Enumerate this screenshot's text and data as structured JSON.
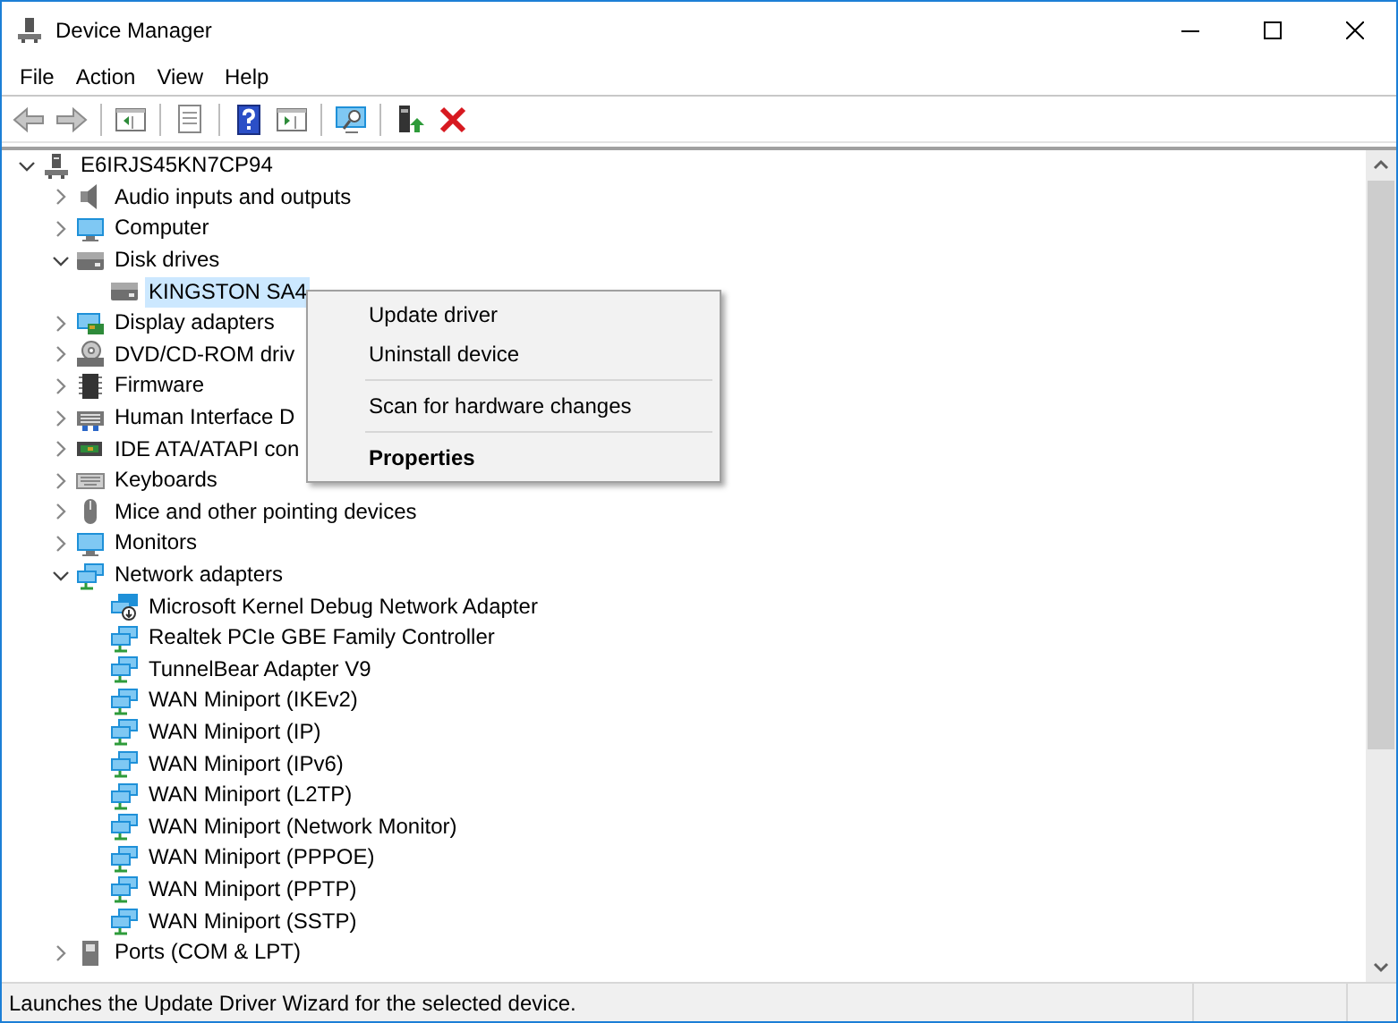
{
  "window": {
    "title": "Device Manager"
  },
  "menu_bar": [
    "File",
    "Action",
    "View",
    "Help"
  ],
  "toolbar": [
    {
      "kind": "back",
      "disabled": true
    },
    {
      "kind": "forward",
      "disabled": true
    },
    {
      "kind": "separator"
    },
    {
      "kind": "tree",
      "disabled": false
    },
    {
      "kind": "separator"
    },
    {
      "kind": "sheet",
      "disabled": false
    },
    {
      "kind": "separator"
    },
    {
      "kind": "help",
      "disabled": false
    },
    {
      "kind": "pane",
      "disabled": false
    },
    {
      "kind": "separator"
    },
    {
      "kind": "scan",
      "disabled": false
    },
    {
      "kind": "separator"
    },
    {
      "kind": "update",
      "disabled": false
    },
    {
      "kind": "remove",
      "disabled": false
    }
  ],
  "tree": {
    "label": "E6IRJS45KN7CP94",
    "kind": "computer",
    "expanded": true,
    "selected": false,
    "children": [
      {
        "label": "Audio inputs and outputs",
        "kind": "audio",
        "expanded": false,
        "selected": false
      },
      {
        "label": "Computer",
        "kind": "monitor",
        "expanded": false,
        "selected": false
      },
      {
        "label": "Disk drives",
        "kind": "disk",
        "expanded": true,
        "selected": false,
        "children": [
          {
            "label": "KINGSTON SA4",
            "kind": "disk",
            "selected": true
          }
        ]
      },
      {
        "label": "Display adapters",
        "kind": "display",
        "expanded": false,
        "selected": false
      },
      {
        "label": "DVD/CD-ROM driv",
        "kind": "dvd",
        "expanded": false,
        "selected": false
      },
      {
        "label": "Firmware",
        "kind": "chip",
        "expanded": false,
        "selected": false
      },
      {
        "label": "Human Interface D",
        "kind": "hid",
        "expanded": false,
        "selected": false
      },
      {
        "label": "IDE ATA/ATAPI con",
        "kind": "card",
        "expanded": false,
        "selected": false
      },
      {
        "label": "Keyboards",
        "kind": "keyboard",
        "expanded": false,
        "selected": false
      },
      {
        "label": "Mice and other pointing devices",
        "kind": "mouse",
        "expanded": false,
        "selected": false
      },
      {
        "label": "Monitors",
        "kind": "monitor",
        "expanded": false,
        "selected": false
      },
      {
        "label": "Network adapters",
        "kind": "network",
        "expanded": true,
        "selected": false,
        "children": [
          {
            "label": "Microsoft Kernel Debug Network Adapter",
            "kind": "debug",
            "selected": false
          },
          {
            "label": "Realtek PCIe GBE Family Controller",
            "kind": "network",
            "selected": false
          },
          {
            "label": "TunnelBear Adapter V9",
            "kind": "network",
            "selected": false
          },
          {
            "label": "WAN Miniport (IKEv2)",
            "kind": "network",
            "selected": false
          },
          {
            "label": "WAN Miniport (IP)",
            "kind": "network",
            "selected": false
          },
          {
            "label": "WAN Miniport (IPv6)",
            "kind": "network",
            "selected": false
          },
          {
            "label": "WAN Miniport (L2TP)",
            "kind": "network",
            "selected": false
          },
          {
            "label": "WAN Miniport (Network Monitor)",
            "kind": "network",
            "selected": false
          },
          {
            "label": "WAN Miniport (PPPOE)",
            "kind": "network",
            "selected": false
          },
          {
            "label": "WAN Miniport (PPTP)",
            "kind": "network",
            "selected": false
          },
          {
            "label": "WAN Miniport (SSTP)",
            "kind": "network",
            "selected": false
          }
        ]
      },
      {
        "label": "Ports (COM & LPT)",
        "kind": "ports",
        "expanded": false,
        "selected": false
      }
    ]
  },
  "context_menu": [
    {
      "kind": "item",
      "label": "Update driver",
      "default": false
    },
    {
      "kind": "item",
      "label": "Uninstall device",
      "default": false
    },
    {
      "kind": "separator"
    },
    {
      "kind": "item",
      "label": "Scan for hardware changes",
      "default": false
    },
    {
      "kind": "separator"
    },
    {
      "kind": "item",
      "label": "Properties",
      "default": true
    }
  ],
  "status_bar": {
    "text": "Launches the Update Driver Wizard for the selected device."
  }
}
